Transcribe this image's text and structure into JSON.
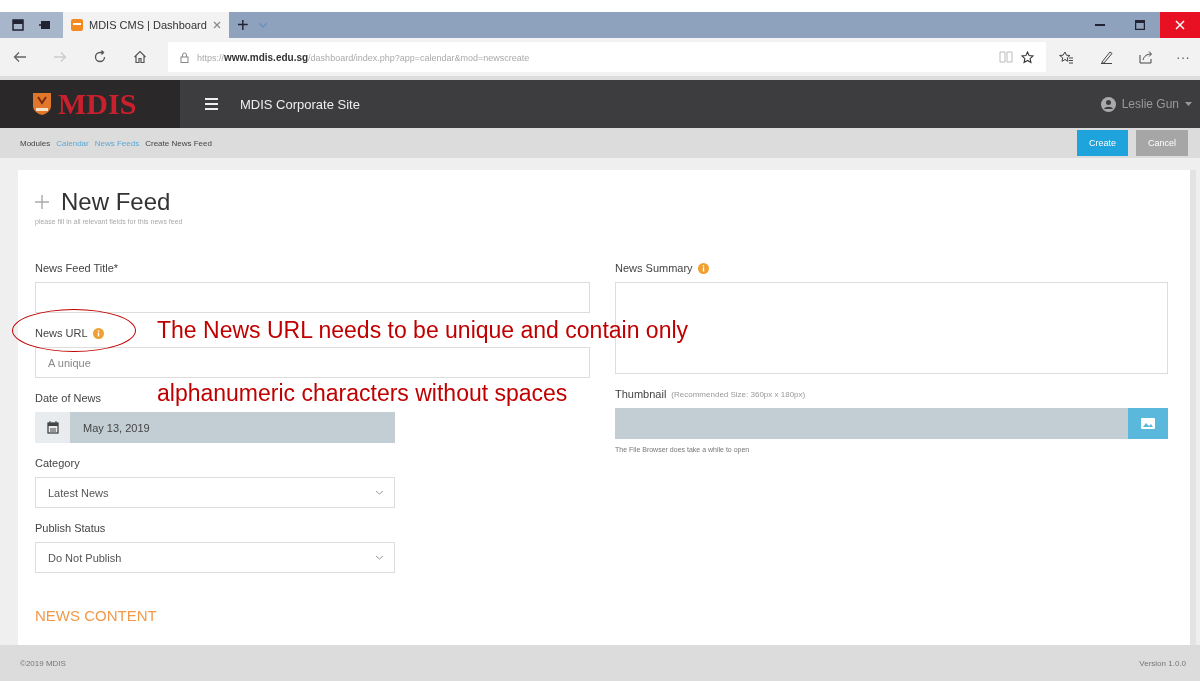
{
  "browser": {
    "tabs": [
      {
        "title": "MDIS CMS | Dashboard",
        "selected": true
      }
    ],
    "new_tab": "+",
    "url": "https://**www.mdis.edu.sg**/dashboard/index.php?app=calendar&mod=newscreate",
    "more": "···"
  },
  "header": {
    "logo": "MDIS",
    "site_title": "MDIS Corporate Site",
    "user": "Leslie Gun"
  },
  "breadcrumb": [
    {
      "label": "Modules",
      "kind": "text"
    },
    {
      "label": "Calendar",
      "kind": "link"
    },
    {
      "label": "News Feeds",
      "kind": "link"
    },
    {
      "label": "Create News Feed",
      "kind": "text"
    }
  ],
  "actions": [
    {
      "label": "Create",
      "kind": "primary"
    },
    {
      "label": "Cancel",
      "kind": "secondary"
    }
  ],
  "form": {
    "title": "New Feed",
    "subtitle": "please fill in all relevant fields for this news feed",
    "left_fields": [
      {
        "label": "News Feed Title*",
        "kind": "text",
        "info": false
      },
      {
        "label": "News URL",
        "kind": "text",
        "info": true,
        "placeholder": "A unique"
      },
      {
        "label": "Date of News",
        "kind": "date",
        "info": false,
        "value": "May 13, 2019"
      },
      {
        "label": "Category",
        "kind": "select",
        "info": false,
        "value": "Latest News"
      },
      {
        "label": "Publish Status",
        "kind": "select",
        "info": false,
        "value": "Do Not Publish"
      }
    ],
    "right_fields": [
      {
        "label": "News Summary",
        "kind": "textarea",
        "info": true
      },
      {
        "label": "Thumbnail",
        "kind": "file",
        "info": false,
        "note": "(Recommended Size: 360px x 180px)",
        "hint": "The File Browser does take a while to open"
      }
    ],
    "section": "NEWS CONTENT"
  },
  "annotation": {
    "lines": [
      "The News URL needs to be unique and contain only",
      "alphanumeric characters without spaces"
    ]
  },
  "footer": {
    "copyright": "©2019 MDIS",
    "version": "Version 1.0.0"
  }
}
